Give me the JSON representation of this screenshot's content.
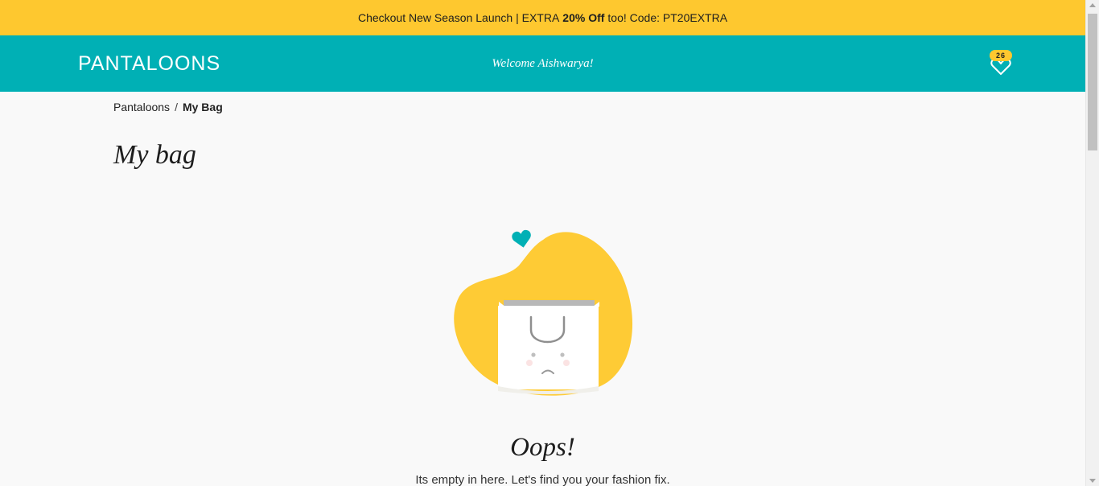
{
  "promo": {
    "text_before": "Checkout New Season Launch | EXTRA",
    "text_bold": "20% Off",
    "text_after": "too! Code: PT20EXTRA"
  },
  "header": {
    "logo_text": "PANTALOONS",
    "welcome": "Welcome Aishwarya!",
    "wishlist_count": "26"
  },
  "breadcrumb": {
    "home": "Pantaloons",
    "separator": "/",
    "current": "My Bag"
  },
  "page": {
    "title": "My bag"
  },
  "empty_state": {
    "heading": "Oops!",
    "message": "Its empty in here. Let's find you your fashion fix."
  },
  "colors": {
    "promo_bg": "#fec82f",
    "header_bg": "#00b0b5",
    "blob": "#fecb35",
    "heart": "#00b0b5"
  },
  "icons": {
    "wishlist": "heart-outline-icon",
    "bag": "shopping-bag-icon",
    "heart": "heart-icon"
  }
}
